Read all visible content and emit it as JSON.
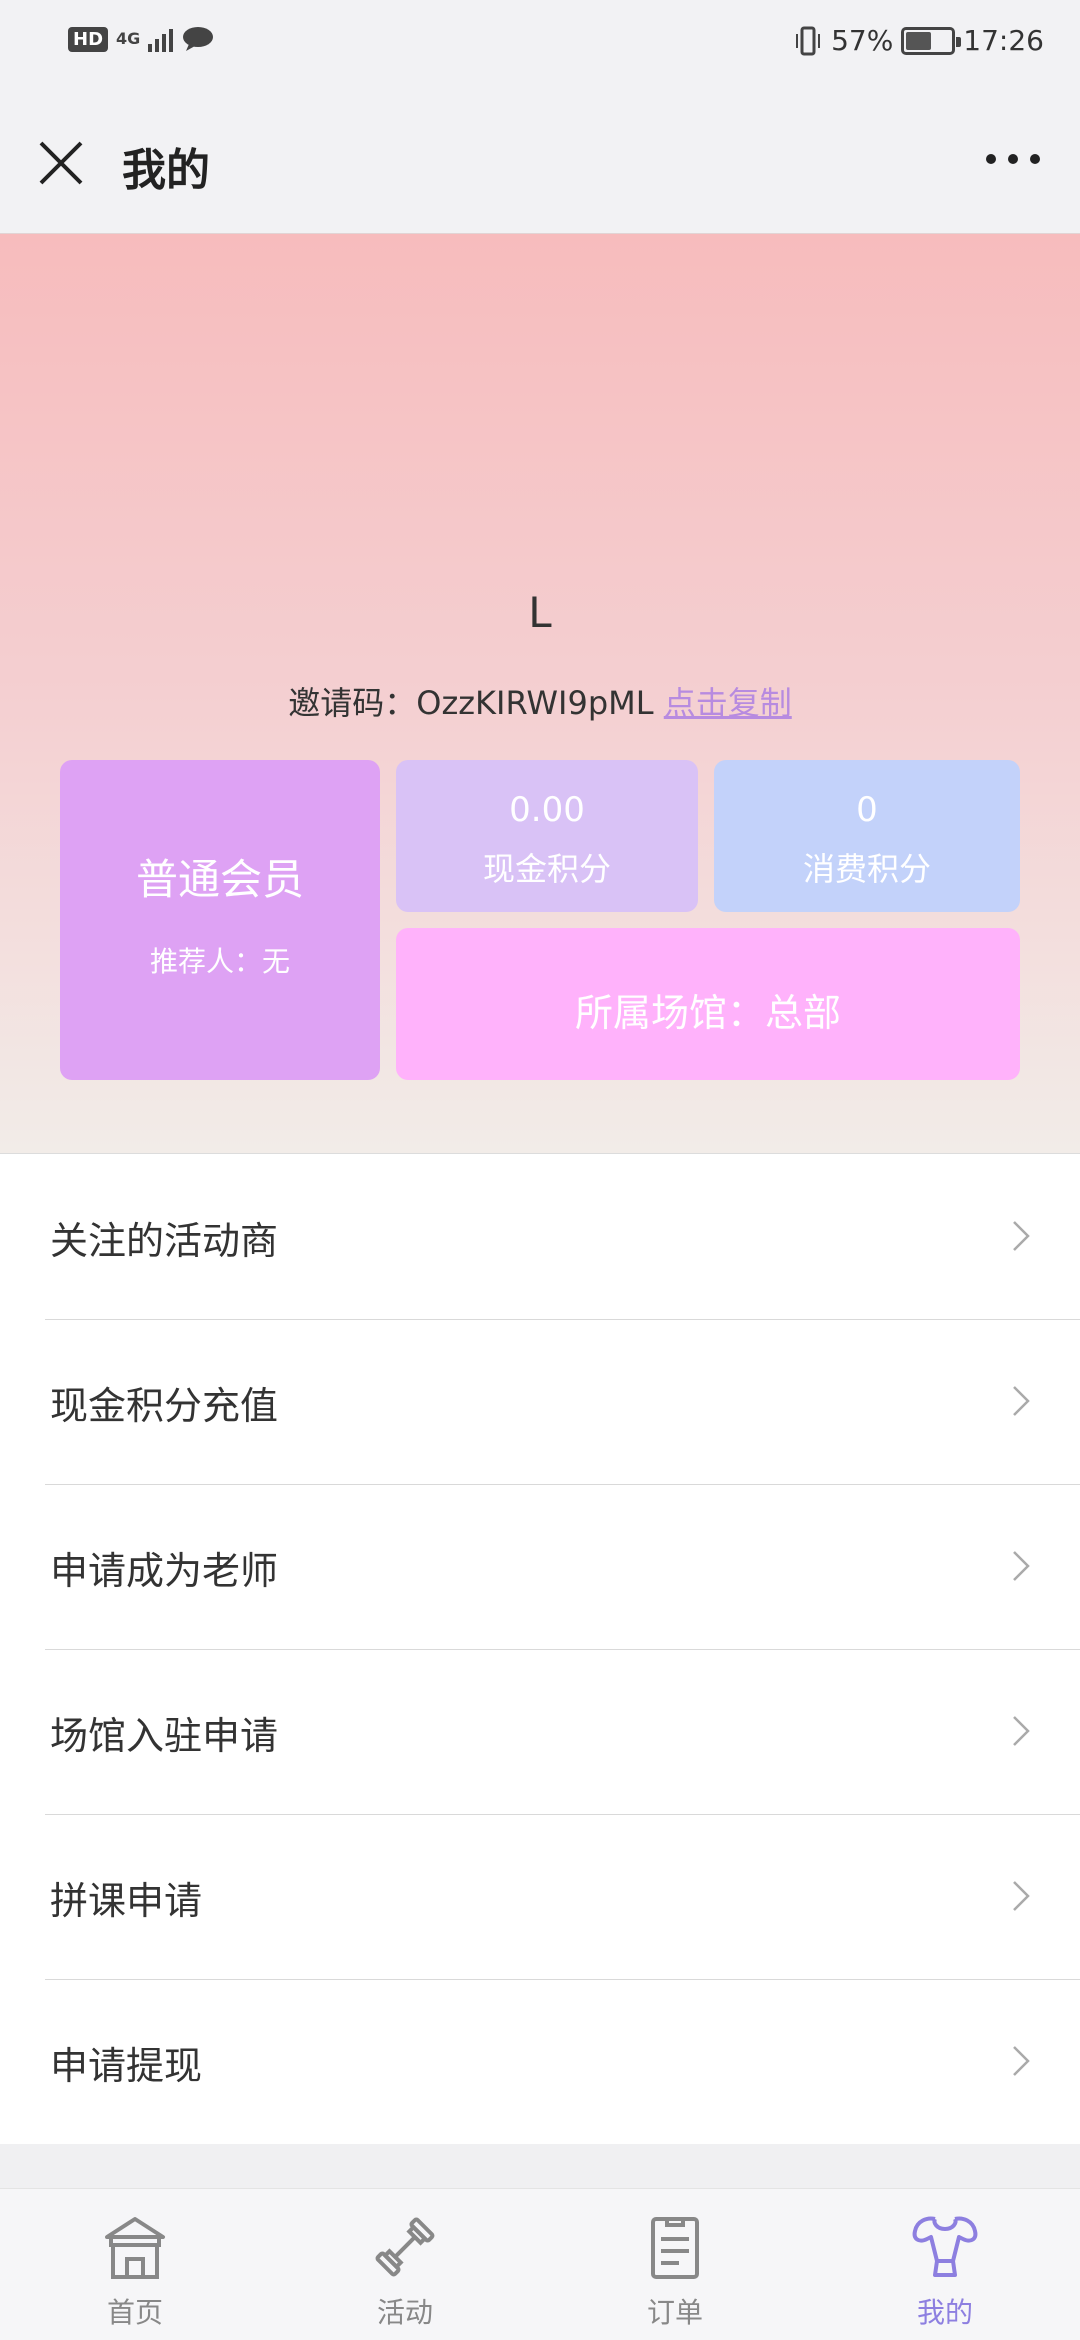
{
  "status_bar": {
    "hd": "HD",
    "network": "4G",
    "battery": "57%",
    "battery_level": 0.57,
    "time": "17:26"
  },
  "nav": {
    "title": "我的"
  },
  "profile": {
    "username": "L",
    "invite_label": "邀请码：",
    "invite_code": "OzzKIRWI9pML",
    "copy_link": "点击复制"
  },
  "cards": {
    "member_level": "普通会员",
    "referrer": "推荐人：无",
    "cash_points_value": "0.00",
    "cash_points_label": "现金积分",
    "spend_points_value": "0",
    "spend_points_label": "消费积分",
    "venue": "所属场馆：总部"
  },
  "menu": [
    {
      "label": "关注的活动商"
    },
    {
      "label": "现金积分充值"
    },
    {
      "label": "申请成为老师"
    },
    {
      "label": "场馆入驻申请"
    },
    {
      "label": "拼课申请"
    },
    {
      "label": "申请提现"
    }
  ],
  "tabs": [
    {
      "label": "首页",
      "icon": "home-icon"
    },
    {
      "label": "活动",
      "icon": "dumbbell-icon"
    },
    {
      "label": "订单",
      "icon": "order-icon"
    },
    {
      "label": "我的",
      "icon": "muscle-icon"
    }
  ],
  "colors": {
    "accent": "#8d7fe0",
    "member_card": "#dea2f4",
    "cash_card": "#d9c2f6",
    "spend_card": "#c3d2fa",
    "venue_card": "#ffb2fb"
  }
}
